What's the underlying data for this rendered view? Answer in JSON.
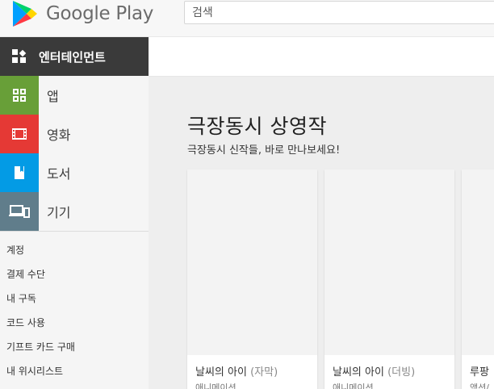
{
  "header": {
    "logo_text": "Google Play",
    "search_placeholder": "검색"
  },
  "sidebar": {
    "active_section": "엔터테인먼트",
    "categories": [
      {
        "label": "앱",
        "color": "#689f38"
      },
      {
        "label": "영화",
        "color": "#e53935"
      },
      {
        "label": "도서",
        "color": "#039be5"
      },
      {
        "label": "기기",
        "color": "#607d8b"
      }
    ],
    "links": [
      "계정",
      "결제 수단",
      "내 구독",
      "코드 사용",
      "기프트 카드 구매",
      "내 위시리스트"
    ]
  },
  "main": {
    "title": "극장동시 상영작",
    "subtitle": "극장동시 신작들, 바로 만나보세요!",
    "cards": [
      {
        "title": "날씨의 아이",
        "title_suffix": "(자막)",
        "genre": "애니메이션"
      },
      {
        "title": "날씨의 아이",
        "title_suffix": "(더빙)",
        "genre": "애니메이션"
      },
      {
        "title": "루팡",
        "title_suffix": "",
        "genre": "액션/"
      }
    ]
  },
  "colors": {
    "entertainment_bg": "#3a3a3a",
    "main_bg": "#eeeeee"
  }
}
